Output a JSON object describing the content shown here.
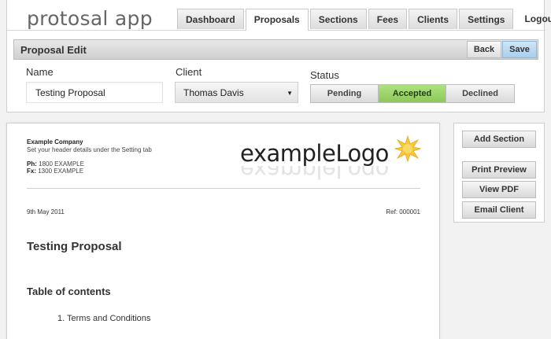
{
  "app": {
    "title": "protosal app"
  },
  "nav": {
    "tabs": [
      {
        "label": "Dashboard"
      },
      {
        "label": "Proposals"
      },
      {
        "label": "Sections"
      },
      {
        "label": "Fees"
      },
      {
        "label": "Clients"
      },
      {
        "label": "Settings"
      }
    ],
    "logout": "Logout"
  },
  "edit_bar": {
    "title": "Proposal Edit",
    "back": "Back",
    "save": "Save"
  },
  "form": {
    "name_label": "Name",
    "name_value": "Testing Proposal",
    "client_label": "Client",
    "client_value": "Thomas Davis",
    "status_label": "Status",
    "status_options": [
      "Pending",
      "Accepted",
      "Declined"
    ],
    "status_selected": "Accepted"
  },
  "document": {
    "company": "Example Company",
    "header_note": "Set your header details under the Setting tab",
    "ph_label": "Ph:",
    "ph_value": "1800 EXAMPLE",
    "fx_label": "Fx:",
    "fx_value": "1300 EXAMPLE",
    "logo_text": "exampleLogo",
    "date": "9th May 2011",
    "ref": "Ref: 000001",
    "title": "Testing Proposal",
    "toc_heading": "Table of contents",
    "toc_items": [
      "1.  Terms and Conditions"
    ]
  },
  "side_panel": {
    "add_section": "Add Section",
    "print_preview": "Print Preview",
    "view_pdf": "View PDF",
    "email_client": "Email Client"
  },
  "colors": {
    "accepted": "#8cc85a",
    "save": "#a9cfee"
  }
}
